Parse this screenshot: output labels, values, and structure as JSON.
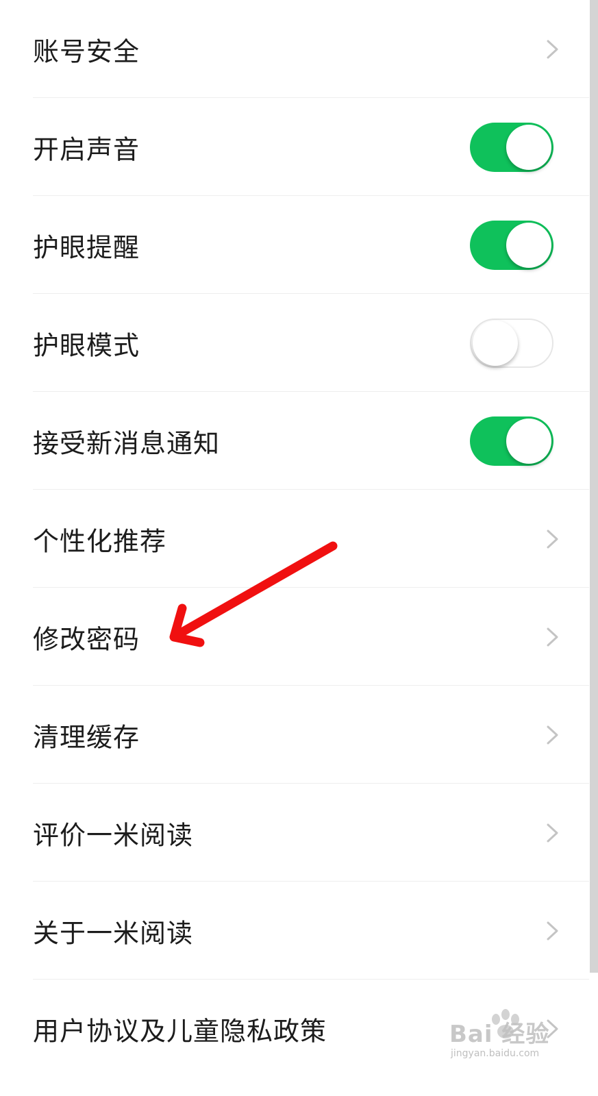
{
  "settings": {
    "items": [
      {
        "label": "账号安全",
        "control": "chevron"
      },
      {
        "label": "开启声音",
        "control": "toggle",
        "on": true
      },
      {
        "label": "护眼提醒",
        "control": "toggle",
        "on": true
      },
      {
        "label": "护眼模式",
        "control": "toggle",
        "on": false
      },
      {
        "label": "接受新消息通知",
        "control": "toggle",
        "on": true
      },
      {
        "label": "个性化推荐",
        "control": "chevron"
      },
      {
        "label": "修改密码",
        "control": "chevron"
      },
      {
        "label": "清理缓存",
        "control": "chevron"
      },
      {
        "label": "评价一米阅读",
        "control": "chevron"
      },
      {
        "label": "关于一米阅读",
        "control": "chevron"
      },
      {
        "label": "用户协议及儿童隐私政策",
        "control": "chevron"
      }
    ]
  },
  "colors": {
    "toggle_on": "#0fc15b",
    "annotation_arrow": "#f01010",
    "text": "#1c1c1c"
  },
  "icons": {
    "chevron": "chevron-right-icon",
    "annotation": "red-arrow-annotation-icon"
  },
  "watermark": {
    "brand": "Bai  经验",
    "url": "jingyan.baidu.com"
  }
}
